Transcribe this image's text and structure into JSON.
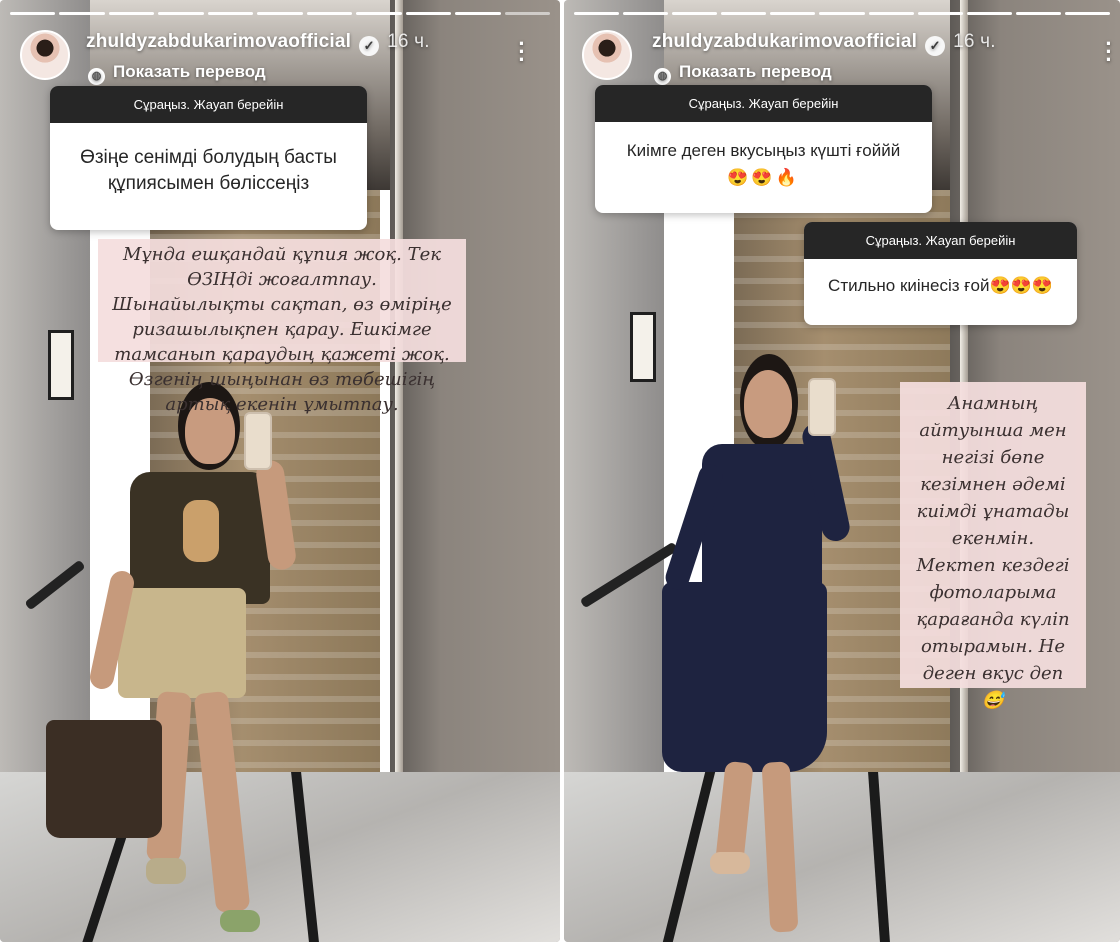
{
  "stories": [
    {
      "username": "zhuldyzabdukarimovaofficial",
      "time_ago": "16 ч.",
      "translate_label": "Показать перевод",
      "progress": {
        "total": 11,
        "completed": 10
      },
      "questions": [
        {
          "header": "Сұраңыз. Жауап берейін",
          "text": "Өзіңе сенімді болудың басты құпиясымен бөлiссеңіз"
        }
      ],
      "answer": "Мұнда ешқандай құпия жоқ. Тек ӨЗІҢді жоғалтпау. Шынайылықты сақтап, өз өміріңе ризашылықпен қарау. Ешкімге тамсанып қараудың қажеті жоқ. Өзгенің шыңынан өз төбешігің артық екенін ұмытпау."
    },
    {
      "username": "zhuldyzabdukarimovaofficial",
      "time_ago": "16 ч.",
      "translate_label": "Показать перевод",
      "progress": {
        "total": 11,
        "completed": 11
      },
      "questions": [
        {
          "header": "Сұраңыз. Жауап берейін",
          "text": "Киімге деген вкусыңыз күшті ғоййй",
          "emojis": "😍😍🔥"
        },
        {
          "header": "Сұраңыз. Жауап берейін",
          "text": "Стильно киінесіз ғой😍😍😍"
        }
      ],
      "answer": "Анамның айтуынша мен негізі бөпе кезімнен әдемі киімді ұнатады екенмін. Мектеп кездегі фотоларыма қарағанда күліп отырамын. Не деген вкус деп 😅"
    }
  ],
  "icons": {
    "verified": "verified-badge-icon",
    "translate": "globe-icon",
    "more": "more-dots-icon"
  },
  "colors": {
    "question_header_bg": "#262626",
    "answer_bg": "#f4dede",
    "text_white": "#ffffff"
  }
}
